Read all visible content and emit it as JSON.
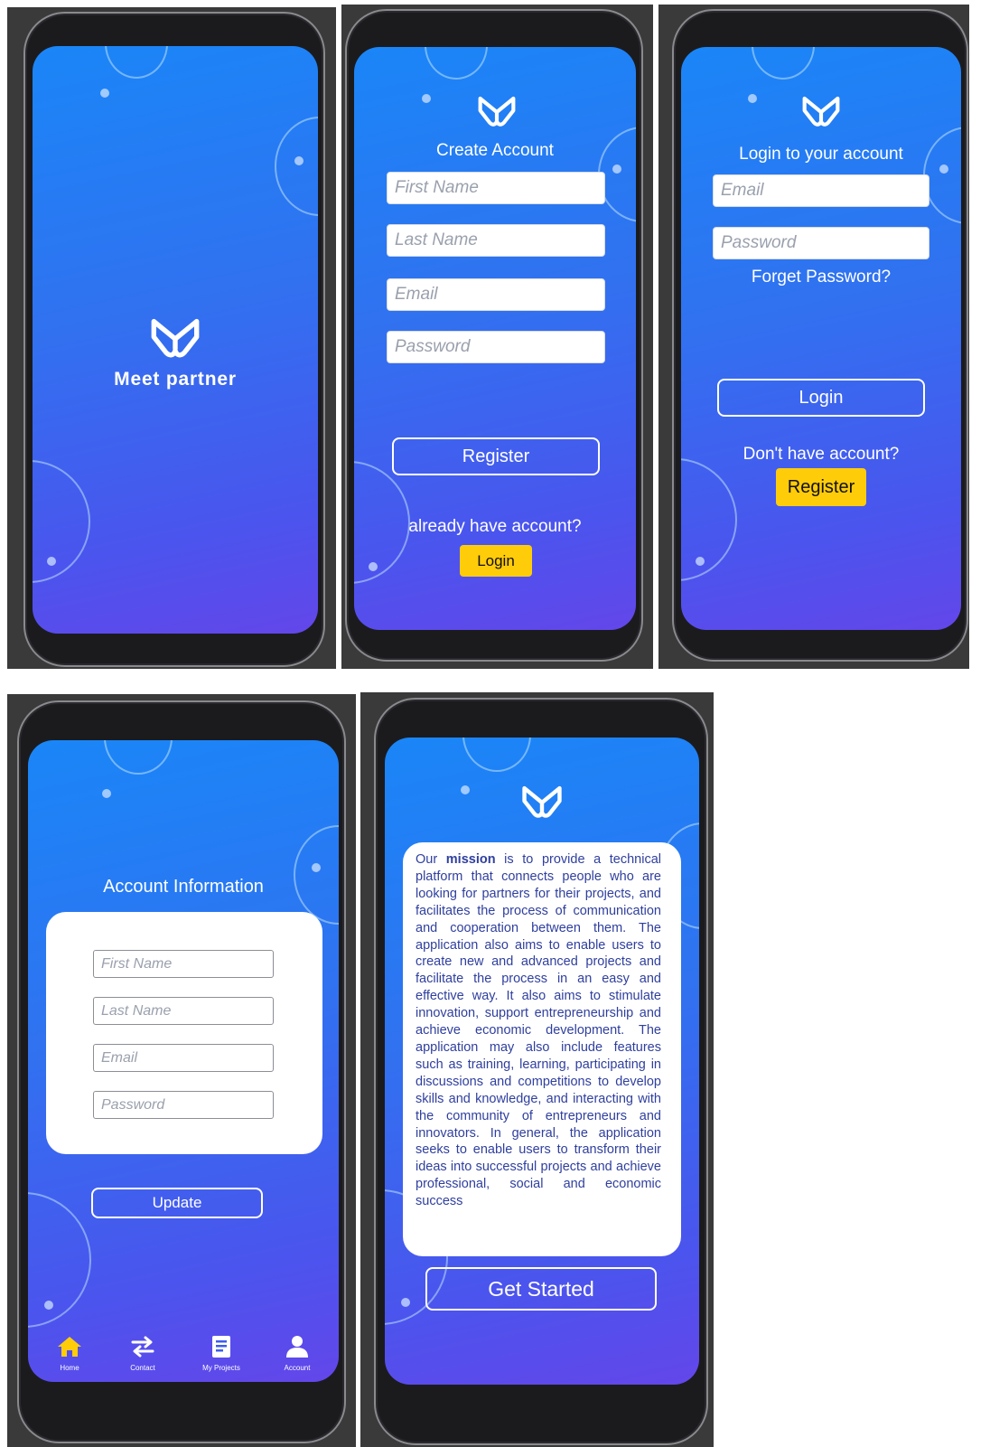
{
  "brand": {
    "name": "Meet partner"
  },
  "create_account": {
    "title": "Create Account",
    "first_name_placeholder": "First Name",
    "last_name_placeholder": "Last Name",
    "email_placeholder": "Email",
    "password_placeholder": "Password",
    "register_label": "Register",
    "have_account_text": "already have account?",
    "login_label": "Login"
  },
  "login": {
    "title": "Login to your account",
    "email_placeholder": "Email",
    "password_placeholder": "Password",
    "forgot_label": "Forget Password?",
    "login_label": "Login",
    "no_account_text": "Don't have account?",
    "register_label": "Register"
  },
  "account": {
    "title": "Account Information",
    "first_name_placeholder": "First Name",
    "last_name_placeholder": "Last Name",
    "email_placeholder": "Email",
    "password_placeholder": "Password",
    "update_label": "Update"
  },
  "bottom_nav": {
    "items": [
      {
        "label": "Home",
        "icon": "home-icon",
        "color": "#ffcc0a"
      },
      {
        "label": "Contact",
        "icon": "swap-arrows-icon",
        "color": "#ffffff"
      },
      {
        "label": "My Projects",
        "icon": "document-icon",
        "color": "#ffffff"
      },
      {
        "label": "Account",
        "icon": "user-icon",
        "color": "#ffffff"
      }
    ]
  },
  "mission": {
    "lead_plain": "Our ",
    "lead_bold": "mission",
    "body": " is to provide a technical platform that connects people who are looking for partners for their projects, and facilitates the process of communication and cooperation between them. The application also aims to enable users to create new and advanced projects and facilitate the process in an easy and effective way. It also aims to stimulate innovation, support entrepreneurship and achieve economic development. The application may also include features such as training, learning, participating in discussions and competitions to develop skills and knowledge, and interacting with the community of entrepreneurs and innovators. In general, the application seeks to enable users to transform their ideas into successful projects and achieve professional, social and economic success",
    "cta_label": "Get Started"
  },
  "colors": {
    "accent_yellow": "#ffcc0a",
    "gradient_top": "#1a86f7",
    "gradient_bottom": "#6346ea",
    "mission_text": "#2f3f9e"
  }
}
